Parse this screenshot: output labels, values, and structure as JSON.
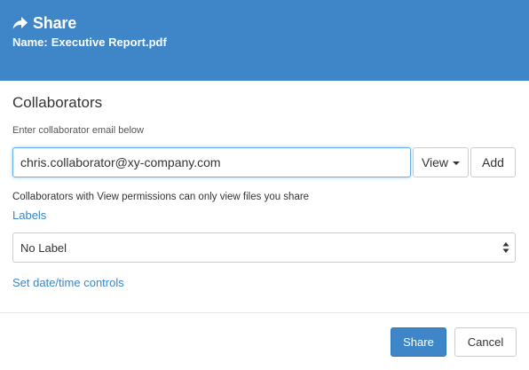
{
  "dialog": {
    "title": "Share",
    "title_icon": "share-arrow-icon",
    "name_label": "Name:",
    "file_name": "Executive Report.pdf"
  },
  "collaborators": {
    "heading": "Collaborators",
    "hint": "Enter collaborator email below",
    "email_value": "chris.collaborator@xy-company.com",
    "permission_label": "View",
    "add_label": "Add",
    "permission_note": "Collaborators with View permissions can only view files you share"
  },
  "labels": {
    "link_text": "Labels",
    "selected": "No Label"
  },
  "datetime": {
    "link_text": "Set date/time controls"
  },
  "footer": {
    "share_label": "Share",
    "cancel_label": "Cancel"
  },
  "colors": {
    "header_bg": "#3f86c8",
    "link": "#3a87c9",
    "primary_button": "#3f86c8"
  }
}
